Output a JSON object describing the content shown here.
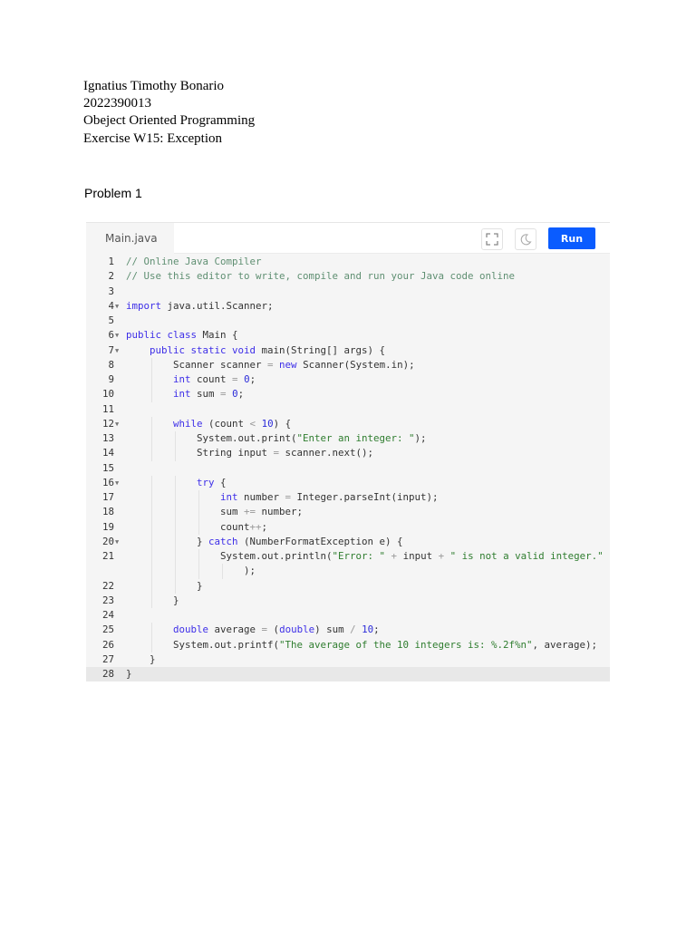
{
  "header": {
    "name": "Ignatius Timothy Bonario",
    "student_id": "2022390013",
    "course": "Obeject Oriented Programming",
    "exercise": "Exercise W15: Exception"
  },
  "problem_title": "Problem 1",
  "editor": {
    "tab_label": "Main.java",
    "run_label": "Run",
    "icons": [
      "fullscreen-icon",
      "dark-mode-moon-icon"
    ],
    "accent_color": "#0a5cff",
    "lines": [
      {
        "n": "1",
        "i": 0,
        "t": [
          [
            "comment",
            "// Online Java Compiler"
          ]
        ]
      },
      {
        "n": "2",
        "i": 0,
        "t": [
          [
            "comment",
            "// Use this editor to write, compile and run your Java code online"
          ]
        ]
      },
      {
        "n": "3",
        "i": 0,
        "t": []
      },
      {
        "n": "4",
        "f": true,
        "i": 0,
        "t": [
          [
            "kw",
            "import"
          ],
          [
            "plain",
            " java.util.Scanner;"
          ]
        ]
      },
      {
        "n": "5",
        "i": 0,
        "t": []
      },
      {
        "n": "6",
        "f": true,
        "i": 0,
        "t": [
          [
            "kw",
            "public class"
          ],
          [
            "plain",
            " Main {"
          ]
        ]
      },
      {
        "n": "7",
        "f": true,
        "i": 1,
        "t": [
          [
            "kw",
            "public static void"
          ],
          [
            "plain",
            " main(String[] args) {"
          ]
        ]
      },
      {
        "n": "8",
        "i": 2,
        "t": [
          [
            "plain",
            "Scanner scanner "
          ],
          [
            "op",
            "="
          ],
          [
            "plain",
            " "
          ],
          [
            "kw",
            "new"
          ],
          [
            "plain",
            " Scanner(System.in);"
          ]
        ]
      },
      {
        "n": "9",
        "i": 2,
        "t": [
          [
            "kw",
            "int"
          ],
          [
            "plain",
            " count "
          ],
          [
            "op",
            "="
          ],
          [
            "plain",
            " "
          ],
          [
            "num",
            "0"
          ],
          [
            "plain",
            ";"
          ]
        ]
      },
      {
        "n": "10",
        "i": 2,
        "t": [
          [
            "kw",
            "int"
          ],
          [
            "plain",
            " sum "
          ],
          [
            "op",
            "="
          ],
          [
            "plain",
            " "
          ],
          [
            "num",
            "0"
          ],
          [
            "plain",
            ";"
          ]
        ]
      },
      {
        "n": "11",
        "i": 0,
        "t": []
      },
      {
        "n": "12",
        "f": true,
        "i": 2,
        "t": [
          [
            "kw",
            "while"
          ],
          [
            "plain",
            " (count "
          ],
          [
            "op",
            "<"
          ],
          [
            "plain",
            " "
          ],
          [
            "num",
            "10"
          ],
          [
            "plain",
            ") {"
          ]
        ]
      },
      {
        "n": "13",
        "i": 3,
        "t": [
          [
            "plain",
            "System.out.print("
          ],
          [
            "str",
            "\"Enter an integer: \""
          ],
          [
            "plain",
            ");"
          ]
        ]
      },
      {
        "n": "14",
        "i": 3,
        "t": [
          [
            "plain",
            "String input "
          ],
          [
            "op",
            "="
          ],
          [
            "plain",
            " scanner.next();"
          ]
        ]
      },
      {
        "n": "15",
        "i": 0,
        "t": []
      },
      {
        "n": "16",
        "f": true,
        "i": 3,
        "t": [
          [
            "kw",
            "try"
          ],
          [
            "plain",
            " {"
          ]
        ]
      },
      {
        "n": "17",
        "i": 4,
        "t": [
          [
            "kw",
            "int"
          ],
          [
            "plain",
            " number "
          ],
          [
            "op",
            "="
          ],
          [
            "plain",
            " Integer.parseInt(input);"
          ]
        ]
      },
      {
        "n": "18",
        "i": 4,
        "t": [
          [
            "plain",
            "sum "
          ],
          [
            "op",
            "+="
          ],
          [
            "plain",
            " number;"
          ]
        ]
      },
      {
        "n": "19",
        "i": 4,
        "t": [
          [
            "plain",
            "count"
          ],
          [
            "op",
            "++"
          ],
          [
            "plain",
            ";"
          ]
        ]
      },
      {
        "n": "20",
        "f": true,
        "i": 3,
        "t": [
          [
            "plain",
            "} "
          ],
          [
            "kw",
            "catch"
          ],
          [
            "plain",
            " (NumberFormatException e) {"
          ]
        ]
      },
      {
        "n": "21",
        "i": 4,
        "t": [
          [
            "plain",
            "System.out.println("
          ],
          [
            "str",
            "\"Error: \""
          ],
          [
            "plain",
            " "
          ],
          [
            "op",
            "+"
          ],
          [
            "plain",
            " input "
          ],
          [
            "op",
            "+"
          ],
          [
            "plain",
            " "
          ],
          [
            "str",
            "\" is not a valid integer.\""
          ]
        ]
      },
      {
        "n": "",
        "i": 5,
        "t": [
          [
            "plain",
            ");"
          ]
        ]
      },
      {
        "n": "22",
        "i": 3,
        "t": [
          [
            "plain",
            "}"
          ]
        ]
      },
      {
        "n": "23",
        "i": 2,
        "t": [
          [
            "plain",
            "}"
          ]
        ]
      },
      {
        "n": "24",
        "i": 0,
        "t": []
      },
      {
        "n": "25",
        "i": 2,
        "t": [
          [
            "kw",
            "double"
          ],
          [
            "plain",
            " average "
          ],
          [
            "op",
            "="
          ],
          [
            "plain",
            " ("
          ],
          [
            "kw",
            "double"
          ],
          [
            "plain",
            ") sum "
          ],
          [
            "op",
            "/"
          ],
          [
            "plain",
            " "
          ],
          [
            "num",
            "10"
          ],
          [
            "plain",
            ";"
          ]
        ]
      },
      {
        "n": "26",
        "i": 2,
        "t": [
          [
            "plain",
            "System.out.printf("
          ],
          [
            "str",
            "\"The average of the 10 integers is: %.2f%n\""
          ],
          [
            "plain",
            ", average);"
          ]
        ]
      },
      {
        "n": "27",
        "i": 1,
        "t": [
          [
            "plain",
            "}"
          ]
        ]
      },
      {
        "n": "28",
        "i": 0,
        "cur": true,
        "t": [
          [
            "plain",
            "}"
          ]
        ]
      }
    ]
  }
}
